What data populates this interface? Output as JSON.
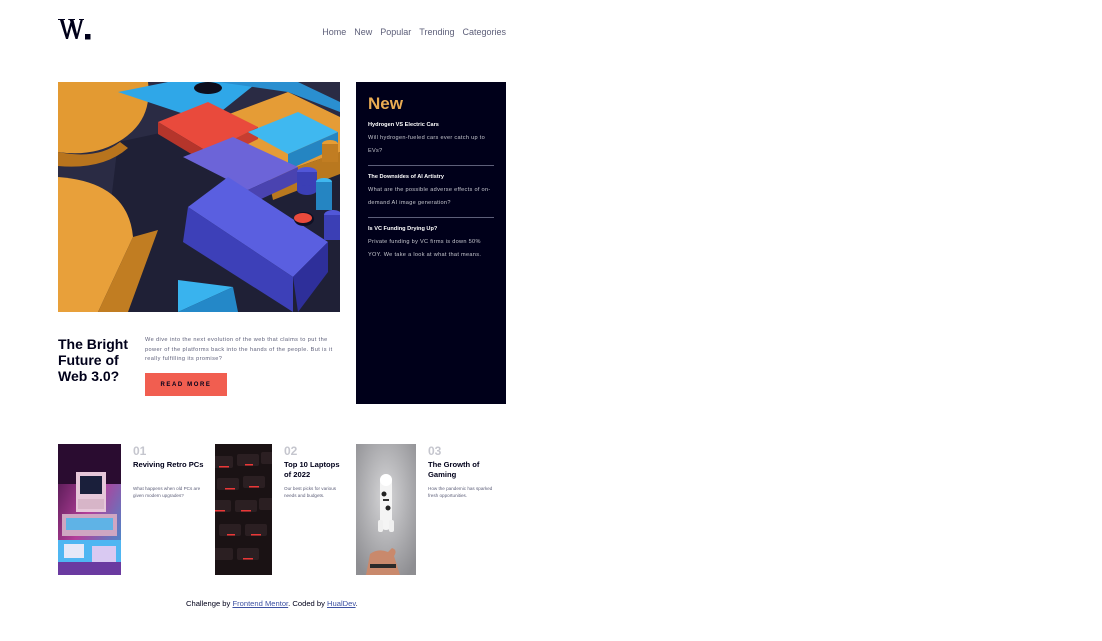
{
  "nav": {
    "items": [
      "Home",
      "New",
      "Popular",
      "Trending",
      "Categories"
    ]
  },
  "hero": {
    "title": "The Bright Future of Web 3.0?",
    "description": "We dive into the next evolution of the web that claims to put the power of the platforms back into the hands of the people. But is it really fulfilling its promise?",
    "button_label": "READ MORE"
  },
  "new_section": {
    "heading": "New",
    "items": [
      {
        "title": "Hydrogen VS Electric Cars",
        "description": "Will hydrogen-fueled cars ever catch up to EVs?"
      },
      {
        "title": "The Downsides of AI Artistry",
        "description": "What are the possible adverse effects of on-demand AI image generation?"
      },
      {
        "title": "Is VC Funding Drying Up?",
        "description": "Private funding by VC firms is down 50% YOY. We take a look at what that means."
      }
    ]
  },
  "cards": [
    {
      "number": "01",
      "title": "Reviving Retro PCs",
      "description": "What happens when old PCs are given modern upgrades?"
    },
    {
      "number": "02",
      "title": "Top 10 Laptops of 2022",
      "description": "Our best picks for various needs and budgets."
    },
    {
      "number": "03",
      "title": "The Growth of Gaming",
      "description": "How the pandemic has sparked fresh opportunities."
    }
  ],
  "footer": {
    "prefix": "Challenge by ",
    "link1": "Frontend Mentor",
    "middle": ". Coded by ",
    "link2": "HualDev",
    "suffix": "."
  },
  "colors": {
    "accent_red": "#f15e50",
    "accent_orange": "#e9ab53",
    "dark_navy": "#00001a",
    "grayish_blue": "#5d5f79",
    "grayish_light": "#c5c6ce"
  }
}
